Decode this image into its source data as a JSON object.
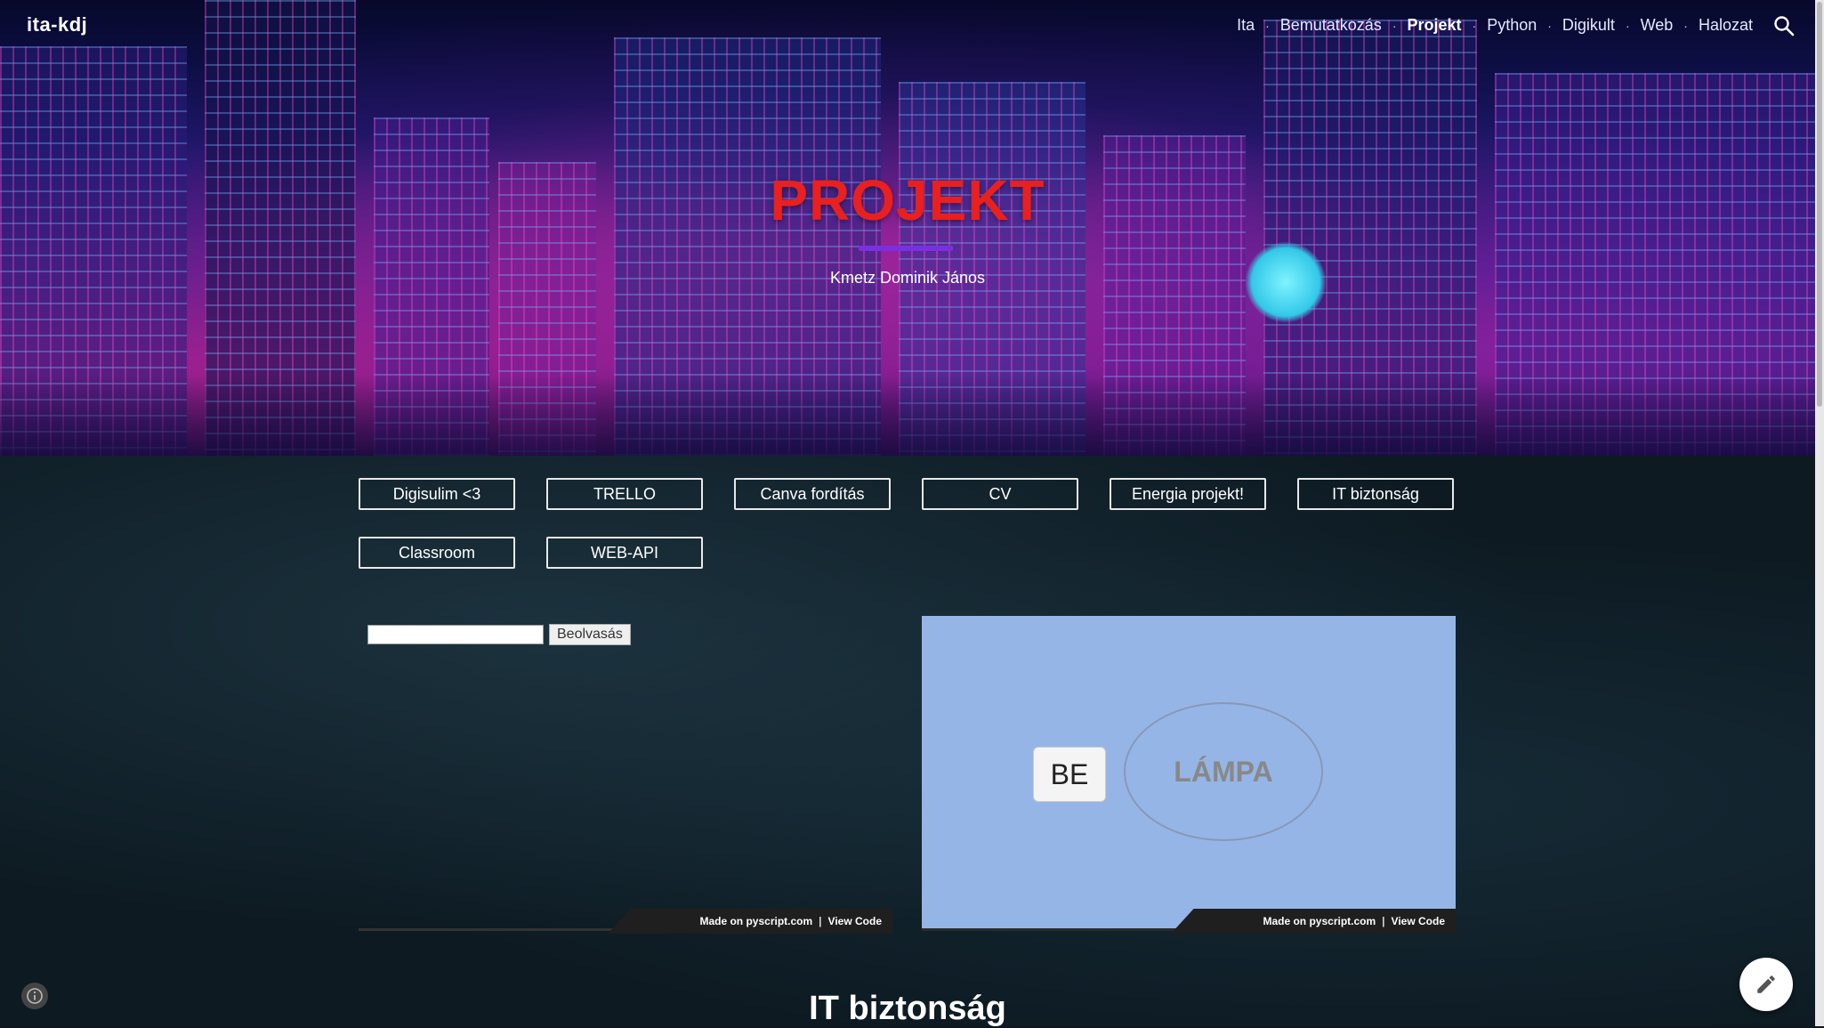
{
  "site": {
    "title": "ita-kdj"
  },
  "nav": {
    "items": [
      {
        "label": "Ita",
        "active": false
      },
      {
        "label": "Bemutatkozás",
        "active": false
      },
      {
        "label": "Projekt",
        "active": true
      },
      {
        "label": "Python",
        "active": false
      },
      {
        "label": "Digikult",
        "active": false
      },
      {
        "label": "Web",
        "active": false
      },
      {
        "label": "Halozat",
        "active": false
      }
    ],
    "search_icon": "search-icon"
  },
  "hero": {
    "title": "PROJEKT",
    "subtitle": "Kmetz Dominik János"
  },
  "buttons": {
    "row1": [
      "Digisulim <3",
      "TRELLO",
      "Canva fordítás",
      "CV",
      "Energia projekt!",
      "IT biztonság"
    ],
    "row2": [
      "Classroom",
      "WEB-API"
    ]
  },
  "embed_left": {
    "input_value": "",
    "read_button": "Beolvasás",
    "footer": {
      "made_on": "Made on pyscript.com",
      "separator": "|",
      "view_code": "View Code"
    }
  },
  "embed_right": {
    "on_button": "BE",
    "lamp_label": "LÁMPA",
    "footer": {
      "made_on": "Made on pyscript.com",
      "separator": "|",
      "view_code": "View Code"
    }
  },
  "section": {
    "title": "IT biztonság"
  },
  "colors": {
    "title_red": "#e8201f",
    "accent_purple": "#7a30e0",
    "lamp_panel_bg": "#95b5e6"
  }
}
